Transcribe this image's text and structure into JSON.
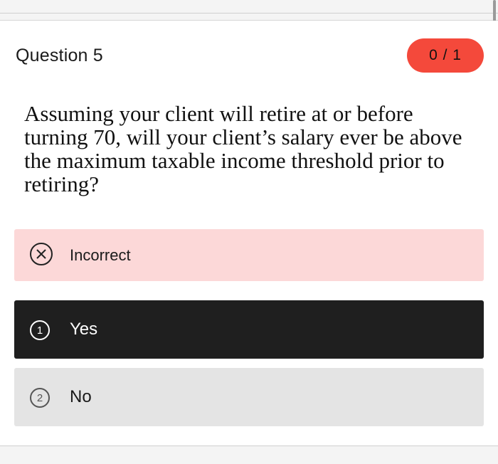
{
  "question": {
    "title": "Question 5",
    "score": "0 / 1",
    "text": "Assuming your client will retire at or before turning 70, will your client’s salary ever be above the maximum taxable income threshold prior to retiring?"
  },
  "feedback": {
    "label": "Incorrect",
    "icon": "x-circle-icon"
  },
  "options": [
    {
      "number": "1",
      "label": "Yes",
      "selected": true
    },
    {
      "number": "2",
      "label": "No",
      "selected": false
    }
  ],
  "colors": {
    "score_badge": "#f4493b",
    "feedback_bg": "#fcd8d8",
    "selected_bg": "#1f1f1f",
    "unselected_bg": "#e4e4e4"
  }
}
